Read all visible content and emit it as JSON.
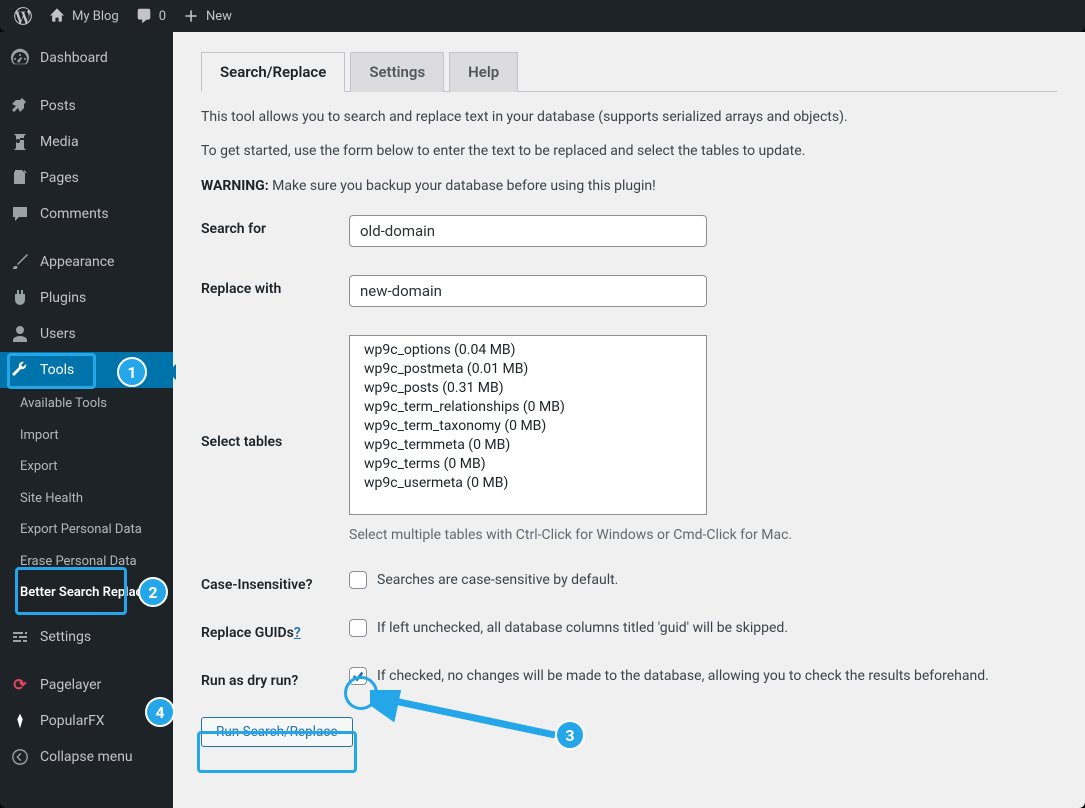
{
  "toolbar": {
    "site_name": "My Blog",
    "comments_count": "0",
    "new_label": "New"
  },
  "sidebar": {
    "dashboard": "Dashboard",
    "posts": "Posts",
    "media": "Media",
    "pages": "Pages",
    "comments": "Comments",
    "appearance": "Appearance",
    "plugins": "Plugins",
    "users": "Users",
    "tools": "Tools",
    "tools_sub": {
      "available": "Available Tools",
      "import": "Import",
      "export": "Export",
      "site_health": "Site Health",
      "export_pd": "Export Personal Data",
      "erase_pd": "Erase Personal Data",
      "bsr": "Better Search Replace"
    },
    "settings": "Settings",
    "pagelayer": "Pagelayer",
    "popularfx": "PopularFX",
    "collapse": "Collapse menu"
  },
  "tabs": {
    "search_replace": "Search/Replace",
    "settings": "Settings",
    "help": "Help"
  },
  "intro": {
    "p1": "This tool allows you to search and replace text in your database (supports serialized arrays and objects).",
    "p2": "To get started, use the form below to enter the text to be replaced and select the tables to update.",
    "warn_label": "WARNING:",
    "warn_text": " Make sure you backup your database before using this plugin!"
  },
  "form": {
    "search_for": {
      "label": "Search for",
      "value": "old-domain"
    },
    "replace_with": {
      "label": "Replace with",
      "value": "new-domain"
    },
    "select_tables": {
      "label": "Select tables",
      "hint": "Select multiple tables with Ctrl-Click for Windows or Cmd-Click for Mac."
    },
    "tables": [
      "wp9c_options (0.04 MB)",
      "wp9c_postmeta (0.01 MB)",
      "wp9c_posts (0.31 MB)",
      "wp9c_term_relationships (0 MB)",
      "wp9c_term_taxonomy (0 MB)",
      "wp9c_termmeta (0 MB)",
      "wp9c_terms (0 MB)",
      "wp9c_usermeta (0 MB)"
    ],
    "case": {
      "label": "Case-Insensitive?",
      "desc": "Searches are case-sensitive by default."
    },
    "guids": {
      "label": "Replace GUIDs",
      "q": "?",
      "desc": "If left unchecked, all database columns titled 'guid' will be skipped."
    },
    "dryrun": {
      "label": "Run as dry run?",
      "desc": "If checked, no changes will be made to the database, allowing you to check the results beforehand."
    },
    "submit": "Run Search/Replace"
  },
  "callouts": {
    "c1": "1",
    "c2": "2",
    "c3": "3",
    "c4": "4"
  }
}
